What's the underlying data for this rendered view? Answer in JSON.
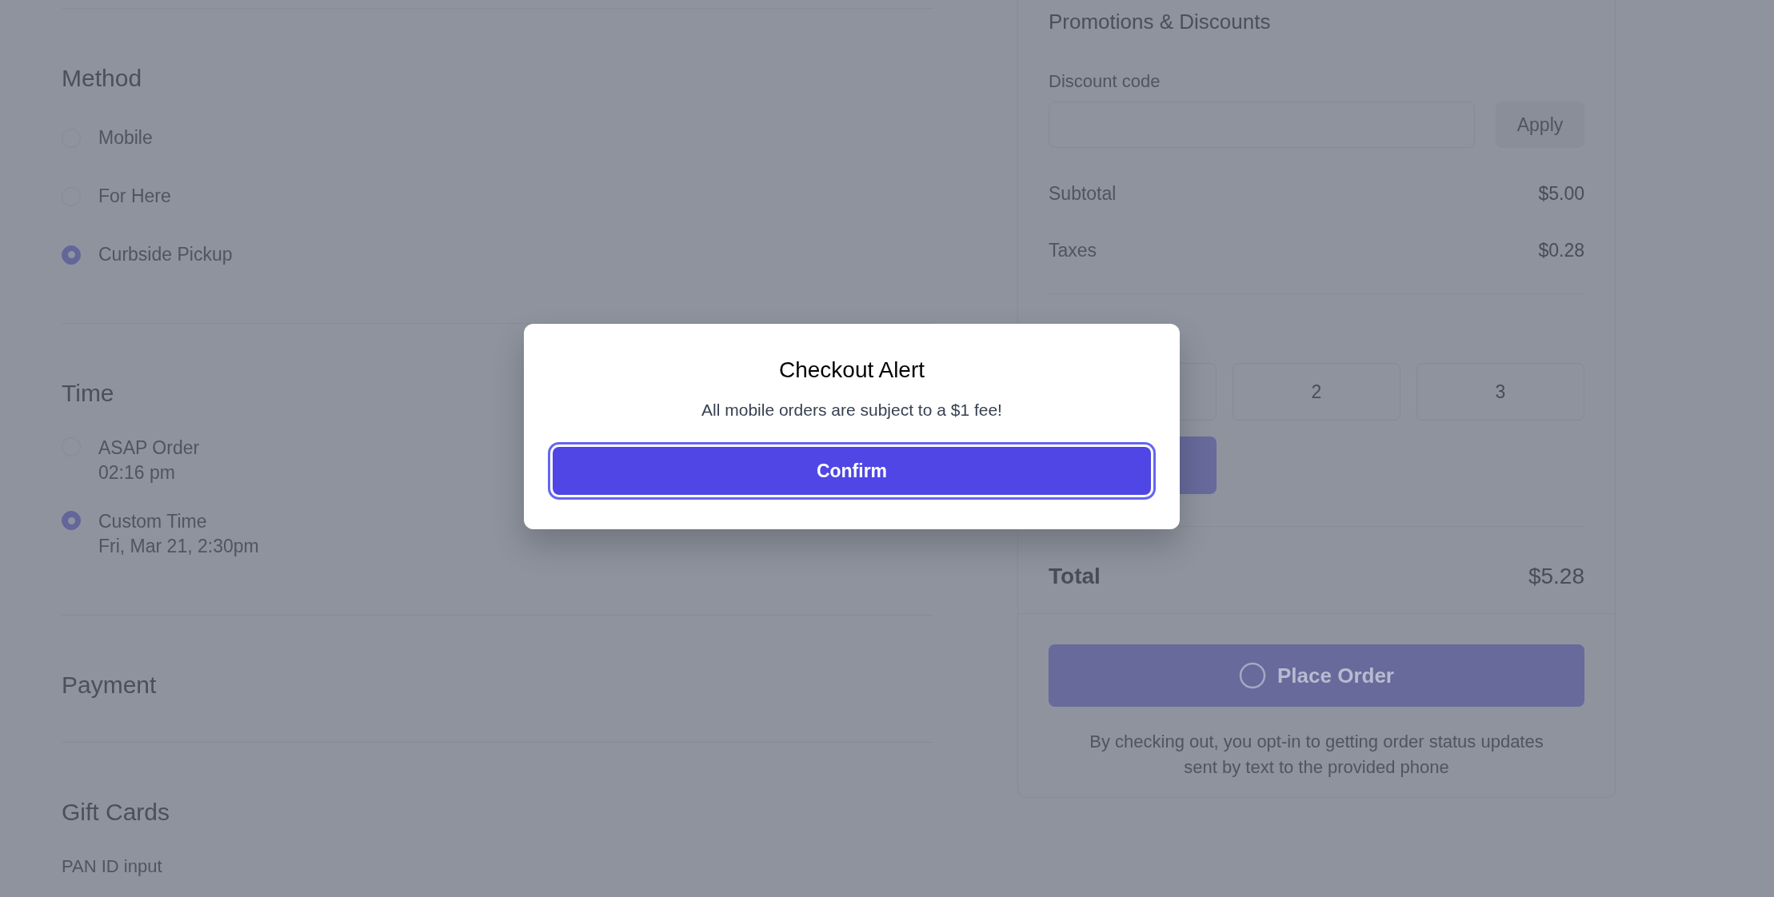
{
  "method": {
    "title": "Method",
    "options": [
      {
        "label": "Mobile",
        "selected": false
      },
      {
        "label": "For Here",
        "selected": false
      },
      {
        "label": "Curbside Pickup",
        "selected": true
      }
    ]
  },
  "time": {
    "title": "Time",
    "options": [
      {
        "label": "ASAP Order",
        "detail": "02:16 pm",
        "selected": false
      },
      {
        "label": "Custom Time",
        "detail": "Fri, Mar 21, 2:30pm",
        "selected": true
      }
    ]
  },
  "payment": {
    "title": "Payment"
  },
  "gift_cards": {
    "title": "Gift Cards",
    "field_label": "PAN ID input"
  },
  "summary": {
    "title": "Promotions & Discounts",
    "discount_label": "Discount code",
    "apply_button": "Apply",
    "lines": [
      {
        "label": "Subtotal",
        "value": "$5.00"
      },
      {
        "label": "Taxes",
        "value": "$0.28"
      }
    ],
    "tip_options": [
      "2",
      "3"
    ],
    "total_label": "Total",
    "total_value": "$5.28",
    "place_order": "Place Order",
    "note": "By checking out, you opt-in to getting order status updates sent by text to the provided phone"
  },
  "modal": {
    "title": "Checkout Alert",
    "message": "All mobile orders are subject to a $1 fee!",
    "button": "Confirm"
  }
}
